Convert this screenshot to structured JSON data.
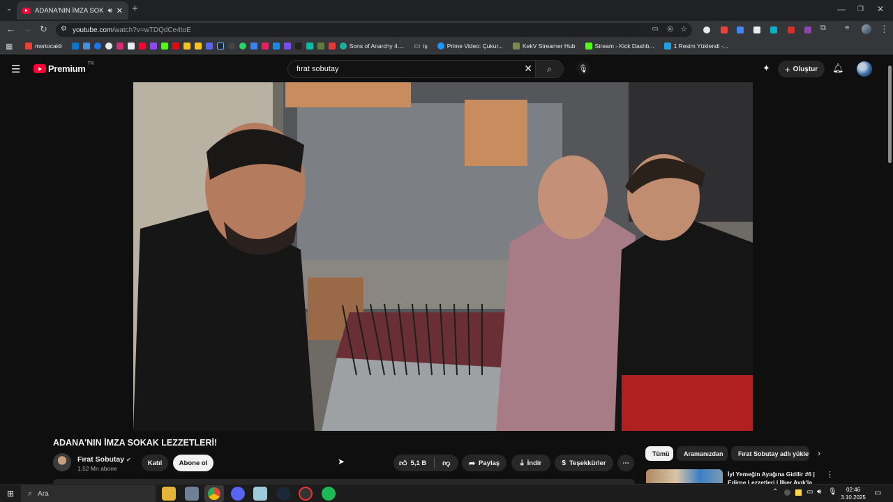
{
  "browser": {
    "tab_title": "ADANA'NIN İMZA SOKAK LEZZETLERİ!",
    "url_host": "youtube.com",
    "url_path": "/watch?v=wTDQdCe4toE",
    "bookmarks": [
      {
        "label": "mertocakli",
        "color": "#ea4335"
      },
      {
        "label": "Sons of Anarchy 4....",
        "color": "#19b39b"
      },
      {
        "label": "iş",
        "color": "#9aa0a6"
      },
      {
        "label": "Prime Video: Çukur...",
        "color": "#1a98ff"
      },
      {
        "label": "KekV Streamer Hub",
        "color": "#7b8a52"
      },
      {
        "label": "Stream - Kick Dashb...",
        "color": "#53fc18"
      },
      {
        "label": "1 Resim Yüklendi -...",
        "color": "#1ba1e2"
      }
    ]
  },
  "youtube": {
    "logo_text": "Premium",
    "logo_region": "TR",
    "search_value": "fırat sobutay",
    "create_label": "Oluştur"
  },
  "video": {
    "title": "ADANA'NIN İMZA SOKAK LEZZETLERİ!",
    "channel": "Fırat Sobutay",
    "subscribers": "1,52 Mn abone",
    "join_label": "Katıl",
    "subscribe_label": "Abone ol",
    "likes": "5,1 B",
    "share_label": "Paylaş",
    "download_label": "İndir",
    "thanks_label": "Teşekkürler"
  },
  "recommendations": {
    "chips": [
      "Tümü",
      "Aramanızdan",
      "Fırat Sobutay adlı yükleyen"
    ],
    "first_title": "İyi Yemeğin Ayağına Gidilir #6 | Edirne Lezzetleri | İlker Ayık'la"
  },
  "taskbar": {
    "search_placeholder": "Ara",
    "time": "02:46",
    "date": "3.10.2025"
  }
}
